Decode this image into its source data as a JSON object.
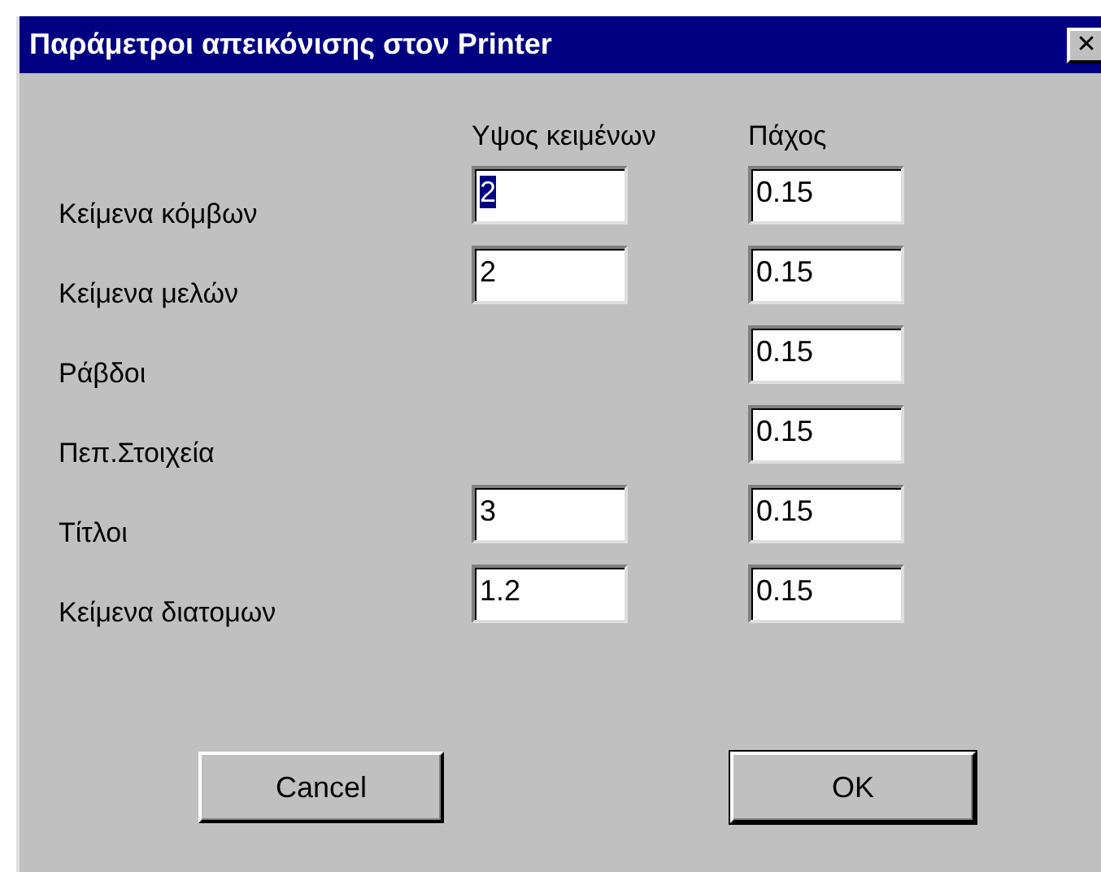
{
  "window": {
    "title": "Παράμετροι απεικόνισης στον Printer",
    "close": "✕"
  },
  "columns": [
    "Υψος κειμένων",
    "Πάχος"
  ],
  "rows": [
    {
      "label": "Κείμενα κόμβων",
      "text_height": {
        "value": "2",
        "highlighted": true
      },
      "thickness": {
        "value": "0.15",
        "highlighted": false
      }
    },
    {
      "label": "Κείμενα μελών",
      "text_height": {
        "value": "2",
        "highlighted": false
      },
      "thickness": {
        "value": "0.15",
        "highlighted": false
      }
    },
    {
      "label": "Ράβδοι",
      "thickness": {
        "value": "0.15",
        "highlighted": false
      }
    },
    {
      "label": "Πεπ.Στοιχεία",
      "thickness": {
        "value": "0.15",
        "highlighted": false
      }
    },
    {
      "label": "Τίτλοι",
      "text_height": {
        "value": "3",
        "highlighted": false
      },
      "thickness": {
        "value": "0.15",
        "highlighted": false
      }
    },
    {
      "label": "Κείμενα διατομων",
      "text_height": {
        "value": "1.2",
        "highlighted": false
      },
      "thickness": {
        "value": "0.15",
        "highlighted": false
      }
    }
  ],
  "buttons": [
    {
      "label": "Cancel",
      "default": false
    },
    {
      "label": "OK",
      "default": true
    }
  ]
}
